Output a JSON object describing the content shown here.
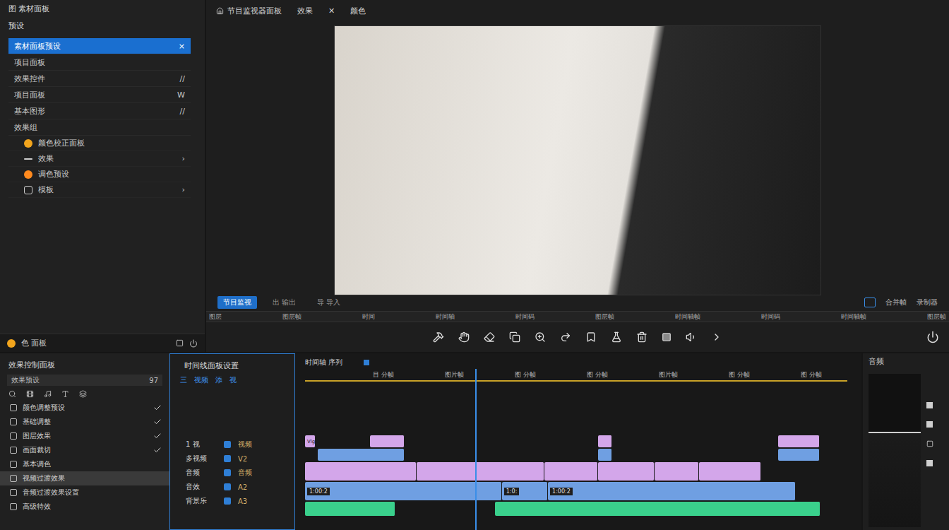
{
  "project_panel": {
    "title": "图 素材面板",
    "subtitle": "预设",
    "items": [
      {
        "label": "素材面板预设",
        "mark": "×",
        "selected": true
      },
      {
        "label": "项目面板",
        "mark": "",
        "selected": false
      },
      {
        "label": "效果控件",
        "mark": "//",
        "selected": false
      },
      {
        "label": "项目面板",
        "mark": "W",
        "selected": false
      },
      {
        "label": "基本图形",
        "mark": "//",
        "selected": false
      },
      {
        "label": "效果组",
        "mark": "",
        "selected": false
      }
    ],
    "subitems": [
      {
        "label": "颜色校正面板",
        "arrow": "",
        "kind": "palette"
      },
      {
        "label": "效果",
        "arrow": "›",
        "kind": "effect"
      },
      {
        "label": "调色预设",
        "arrow": "",
        "kind": "color"
      },
      {
        "label": "模板",
        "arrow": "›",
        "kind": "template"
      }
    ],
    "footer": "色 面板"
  },
  "monitor": {
    "tabs": [
      "节目监视器面板",
      "效果",
      "✕",
      "颜色"
    ],
    "buttons": [
      {
        "label": "节目监视",
        "selected": true
      },
      {
        "label": "出 输出",
        "selected": false
      },
      {
        "label": "导 导入",
        "selected": false
      }
    ],
    "right": [
      "合并帧",
      "录制器"
    ],
    "ruler": [
      "图层",
      "图层帧",
      "时间",
      "时间轴",
      "时间码",
      "图层帧",
      "时间轴帧",
      "时间码",
      "时间轴帧",
      "图层帧"
    ]
  },
  "effects_panel": {
    "title": "效果控制面板",
    "search": {
      "value": "效果预设",
      "count": "97"
    },
    "rows": [
      {
        "label": "颜色调整预设",
        "checked": true,
        "selected": false
      },
      {
        "label": "基础调整",
        "checked": true,
        "selected": false
      },
      {
        "label": "图层效果",
        "checked": true,
        "selected": false
      },
      {
        "label": "画面裁切",
        "checked": true,
        "selected": false
      },
      {
        "label": "基本调色",
        "checked": false,
        "selected": false
      },
      {
        "label": "视频过渡效果",
        "checked": false,
        "selected": true
      },
      {
        "label": "音频过渡效果设置",
        "checked": false,
        "selected": false
      },
      {
        "label": "高级特效",
        "checked": false,
        "selected": false
      }
    ]
  },
  "track_panel": {
    "title": "时间线面板设置",
    "tools": [
      "三",
      "视频",
      "添",
      "视"
    ],
    "tracks": [
      {
        "name": "1 视",
        "tag": "视频"
      },
      {
        "name": "多视频",
        "tag": "V2"
      },
      {
        "name": "音频",
        "tag": "音频"
      },
      {
        "name": "音效",
        "tag": "A2"
      },
      {
        "name": "背景乐",
        "tag": "A3"
      }
    ]
  },
  "timeline": {
    "title": "时间轴 序列",
    "ruler": [
      "目 分帧",
      "图片帧",
      "图 分帧",
      "图 分帧",
      "图片帧",
      "图 分帧",
      "图 分帧"
    ],
    "playhead": 0.314,
    "tracks": [
      {
        "kind": "title",
        "color": "#d3a6ea",
        "clips": [
          {
            "start": 0,
            "duration": 2,
            "label": "Vlg"
          },
          {
            "start": 12,
            "duration": 6.3,
            "label": ""
          },
          {
            "start": 54,
            "duration": 2.7,
            "label": ""
          },
          {
            "start": 87.3,
            "duration": 7.6,
            "label": ""
          }
        ]
      },
      {
        "kind": "title",
        "color": "#6f9fe2",
        "clips": [
          {
            "start": 2.4,
            "duration": 16,
            "label": ""
          },
          {
            "start": 54,
            "duration": 2.7,
            "label": ""
          },
          {
            "start": 87.3,
            "duration": 7.6,
            "label": ""
          }
        ]
      },
      {
        "kind": "video",
        "color": "#d3a6ea",
        "clips": [
          {
            "start": 0,
            "duration": 20.6,
            "label": ""
          },
          {
            "start": 20.6,
            "duration": 23.6,
            "label": ""
          },
          {
            "start": 44.2,
            "duration": 9.8,
            "label": ""
          },
          {
            "start": 54,
            "duration": 10.5,
            "label": ""
          },
          {
            "start": 64.5,
            "duration": 8.2,
            "label": ""
          },
          {
            "start": 72.7,
            "duration": 11.4,
            "label": ""
          }
        ]
      },
      {
        "kind": "video",
        "color": "#6f9fe2",
        "clips": [
          {
            "start": 0,
            "duration": 36.3,
            "label": "1:00:2"
          },
          {
            "start": 36.3,
            "duration": 8.5,
            "label": "1:0:"
          },
          {
            "start": 44.8,
            "duration": 45.7,
            "label": "1:00:2"
          }
        ]
      },
      {
        "kind": "audio",
        "color": "#3ad08c",
        "clips": [
          {
            "start": 0,
            "duration": 16.7,
            "label": ""
          },
          {
            "start": 35,
            "duration": 60,
            "label": ""
          }
        ]
      }
    ]
  },
  "audio_panel": {
    "title": "音频",
    "level": 0.62
  }
}
